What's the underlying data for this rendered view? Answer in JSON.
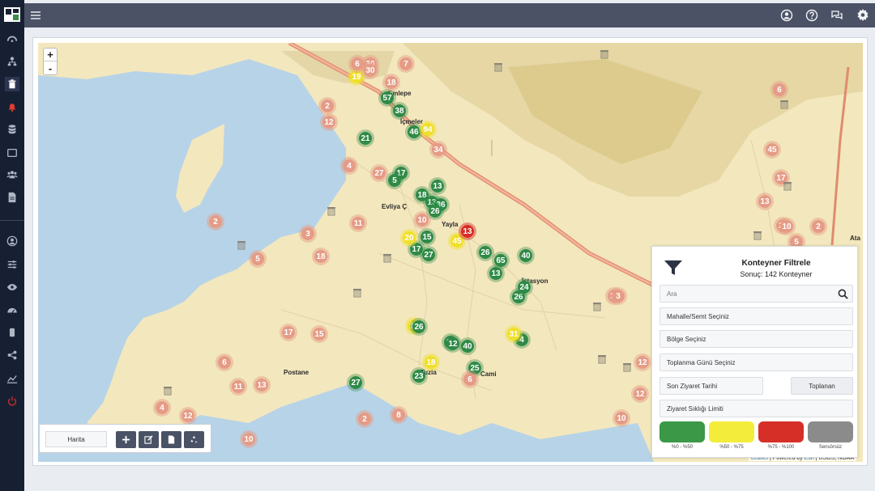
{
  "topbar": {
    "menu_icon": "hamburger-icon",
    "icons": [
      "user-icon",
      "help-icon",
      "chat-icon",
      "gear-icon"
    ]
  },
  "sidebar": {
    "icons": [
      "dashboard-icon",
      "network-icon",
      "trash-icon",
      "bell-icon",
      "database-icon",
      "tablet-icon",
      "users-icon",
      "document-icon",
      "user-circle-icon",
      "sliders-icon",
      "eye-icon",
      "speedometer-icon",
      "cylinder-icon",
      "share-icon",
      "chart-icon",
      "power-icon"
    ],
    "active": "trash-icon"
  },
  "map": {
    "zoom_in": "+",
    "zoom_out": "-",
    "labels": [
      "Emlepe",
      "İçmeler",
      "Evliya Ç",
      "Yayla",
      "İstasyon",
      "Postane",
      "Tuzla",
      "Cami",
      "Ata"
    ],
    "clusters": [
      {
        "n": "19",
        "c": "y"
      },
      {
        "n": "57",
        "c": "g"
      },
      {
        "n": "38",
        "c": "g"
      },
      {
        "n": "46",
        "c": "g"
      },
      {
        "n": "94",
        "c": "y"
      },
      {
        "n": "21",
        "c": "g"
      },
      {
        "n": "17",
        "c": "g"
      },
      {
        "n": "13",
        "c": "g"
      },
      {
        "n": "5",
        "c": "g"
      },
      {
        "n": "13",
        "c": "g"
      },
      {
        "n": "18",
        "c": "g"
      },
      {
        "n": "36",
        "c": "g"
      },
      {
        "n": "26",
        "c": "g"
      },
      {
        "n": "17",
        "c": "g"
      },
      {
        "n": "20",
        "c": "y"
      },
      {
        "n": "15",
        "c": "g"
      },
      {
        "n": "45",
        "c": "y"
      },
      {
        "n": "27",
        "c": "g"
      },
      {
        "n": "13",
        "c": "r"
      },
      {
        "n": "65",
        "c": "g"
      },
      {
        "n": "13",
        "c": "g"
      },
      {
        "n": "26",
        "c": "g"
      },
      {
        "n": "40",
        "c": "g"
      },
      {
        "n": "26",
        "c": "g"
      },
      {
        "n": "4",
        "c": "g"
      },
      {
        "n": "31",
        "c": "y"
      },
      {
        "n": "24",
        "c": "g"
      },
      {
        "n": "11",
        "c": "y"
      },
      {
        "n": "26",
        "c": "g"
      },
      {
        "n": "40",
        "c": "g"
      },
      {
        "n": "15",
        "c": "g"
      },
      {
        "n": "12",
        "c": "g"
      },
      {
        "n": "25",
        "c": "g"
      },
      {
        "n": "18",
        "c": "y"
      },
      {
        "n": "23",
        "c": "g"
      },
      {
        "n": "27",
        "c": "g"
      },
      {
        "n": "30",
        "c": "s"
      },
      {
        "n": "6",
        "c": "s"
      },
      {
        "n": "30",
        "c": "s"
      },
      {
        "n": "7",
        "c": "s"
      },
      {
        "n": "2",
        "c": "s"
      },
      {
        "n": "18",
        "c": "s"
      },
      {
        "n": "12",
        "c": "s"
      },
      {
        "n": "34",
        "c": "s"
      },
      {
        "n": "27",
        "c": "s"
      },
      {
        "n": "4",
        "c": "s"
      },
      {
        "n": "2",
        "c": "s"
      },
      {
        "n": "3",
        "c": "s"
      },
      {
        "n": "5",
        "c": "s"
      },
      {
        "n": "11",
        "c": "s"
      },
      {
        "n": "18",
        "c": "s"
      },
      {
        "n": "10",
        "c": "s"
      },
      {
        "n": "17",
        "c": "s"
      },
      {
        "n": "13",
        "c": "s"
      },
      {
        "n": "6",
        "c": "s"
      },
      {
        "n": "11",
        "c": "s"
      },
      {
        "n": "10",
        "c": "s"
      },
      {
        "n": "4",
        "c": "s"
      },
      {
        "n": "12",
        "c": "s"
      },
      {
        "n": "2",
        "c": "s"
      },
      {
        "n": "15",
        "c": "s"
      },
      {
        "n": "8",
        "c": "s"
      },
      {
        "n": "6",
        "c": "s"
      },
      {
        "n": "45",
        "c": "s"
      },
      {
        "n": "17",
        "c": "s"
      },
      {
        "n": "13",
        "c": "s"
      },
      {
        "n": "23",
        "c": "s"
      },
      {
        "n": "10",
        "c": "s"
      },
      {
        "n": "5",
        "c": "s"
      },
      {
        "n": "2",
        "c": "s"
      },
      {
        "n": "6",
        "c": "s"
      },
      {
        "n": "12",
        "c": "s"
      },
      {
        "n": "3",
        "c": "s"
      },
      {
        "n": "12",
        "c": "s"
      },
      {
        "n": "10",
        "c": "s"
      },
      {
        "n": "6",
        "c": "s"
      },
      {
        "n": "12",
        "c": "s"
      }
    ],
    "attribution_leaflet": "Leaflet",
    "attribution_rest": "| Powered by",
    "attribution_esri": "Esri",
    "attribution_tail": "| USGS, NOAA"
  },
  "filter": {
    "title": "Konteyner Filtrele",
    "subtitle": "Sonuç: 142 Konteyner",
    "search_placeholder": "Ara",
    "neighborhood": "Mahalle/Semt Seçiniz",
    "region": "Bölge Seçiniz",
    "collection_day": "Toplanma Günü Seçiniz",
    "last_visit": "Son Ziyaret Tarihi",
    "collected_button": "Toplanan",
    "visit_limit": "Ziyaret Sıklığı Limiti",
    "levels": [
      {
        "label": "%0 - %50",
        "color": "#3a9846"
      },
      {
        "label": "%50 - %75",
        "color": "#f4ec3a"
      },
      {
        "label": "%75 - %100",
        "color": "#d52f27"
      },
      {
        "label": "Sensörsüz",
        "color": "#8b8b8b"
      }
    ]
  },
  "bottombar": {
    "map_label": "Harita",
    "buttons": [
      "plus-icon",
      "edit-icon",
      "document-icon",
      "recycle-icon"
    ]
  }
}
